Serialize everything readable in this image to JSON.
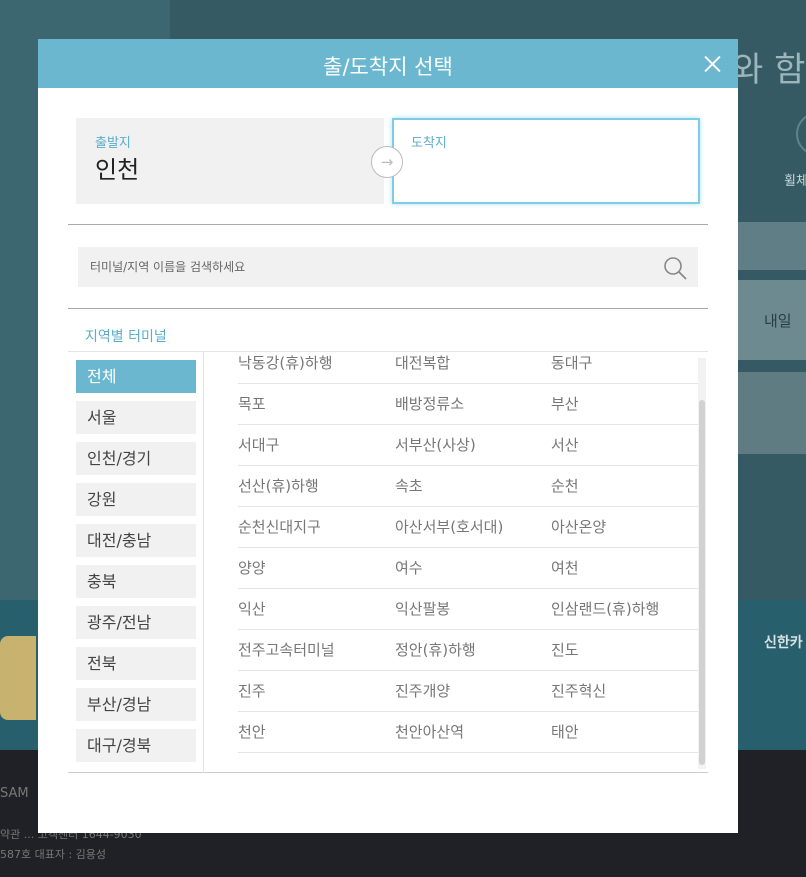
{
  "background": {
    "headline": "와 함",
    "side_label": "휠체",
    "card_text": "내일",
    "card_brand": "신한카",
    "footer_logo": "SAM",
    "footer_line1": "약관 ... 고객센터 1644-9030",
    "footer_line2": "587호 대표자 : 김용성"
  },
  "modal": {
    "title": "출/도착지 선택",
    "departure": {
      "label": "출발지",
      "value": "인천"
    },
    "arrival": {
      "label": "도착지",
      "value": ""
    },
    "search": {
      "placeholder": "터미널/지역 이름을 검색하세요"
    },
    "region_title": "지역별 터미널",
    "regions": [
      "전체",
      "서울",
      "인천/경기",
      "강원",
      "대전/충남",
      "충북",
      "광주/전남",
      "전북",
      "부산/경남",
      "대구/경북"
    ],
    "terminals": [
      [
        "낙동강(휴)하행",
        "대전복합",
        "동대구"
      ],
      [
        "목포",
        "배방정류소",
        "부산"
      ],
      [
        "서대구",
        "서부산(사상)",
        "서산"
      ],
      [
        "선산(휴)하행",
        "속초",
        "순천"
      ],
      [
        "순천신대지구",
        "아산서부(호서대)",
        "아산온양"
      ],
      [
        "양양",
        "여수",
        "여천"
      ],
      [
        "익산",
        "익산팔봉",
        "인삼랜드(휴)하행"
      ],
      [
        "전주고속터미널",
        "정안(휴)하행",
        "진도"
      ],
      [
        "진주",
        "진주개양",
        "진주혁신"
      ],
      [
        "천안",
        "천안아산역",
        "태안"
      ]
    ]
  },
  "colors": {
    "accent": "#6ab7cf",
    "label": "#5aaec9"
  }
}
